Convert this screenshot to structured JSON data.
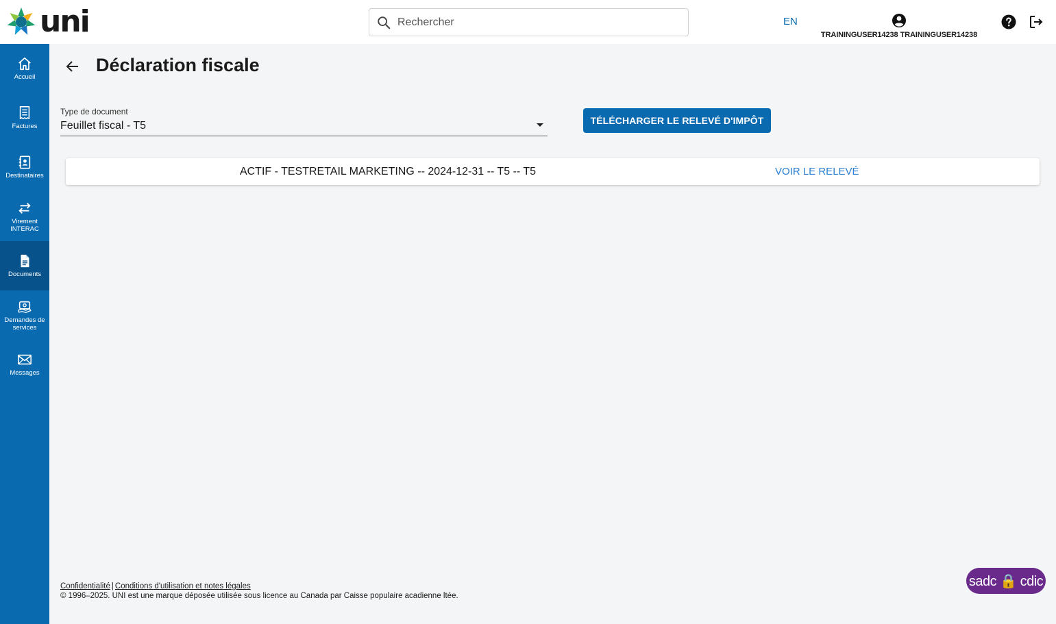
{
  "header": {
    "logo_text": "UNI",
    "search_placeholder": "Rechercher",
    "lang_toggle": "EN",
    "user_name": "TRAININGUSER14238 TRAININGUSER14238"
  },
  "sidebar": {
    "items": [
      {
        "label": "Accueil"
      },
      {
        "label": "Factures"
      },
      {
        "label": "Destinataires"
      },
      {
        "label": "Virement\nINTERAC"
      },
      {
        "label": "Documents"
      },
      {
        "label": "Demandes de\nservices"
      },
      {
        "label": "Messages"
      }
    ]
  },
  "main": {
    "title": "Déclaration fiscale",
    "doc_type_label": "Type de document",
    "doc_type_value": "Feuillet fiscal - T5",
    "download_button": "TÉLÉCHARGER LE RELEVÉ D'IMPÔT",
    "statement": {
      "text": "ACTIF - TESTRETAIL MARKETING -- 2024-12-31 -- T5 -- T5",
      "link": "VOIR LE RELEVÉ"
    }
  },
  "footer": {
    "privacy_link": "Confidentialité",
    "separator": "|",
    "terms_link": "Conditions d'utilisation et notes légales",
    "copyright": "© 1996–2025. UNI est une marque déposée utilisée sous licence au Canada par Caisse populaire acadienne ltée.",
    "badge": "sadc 🔒 cdic"
  },
  "colors": {
    "primary": "#0a6ab0",
    "sidebar_active": "#07528a",
    "link": "#2a7fd0",
    "badge": "#6a2a8c"
  }
}
